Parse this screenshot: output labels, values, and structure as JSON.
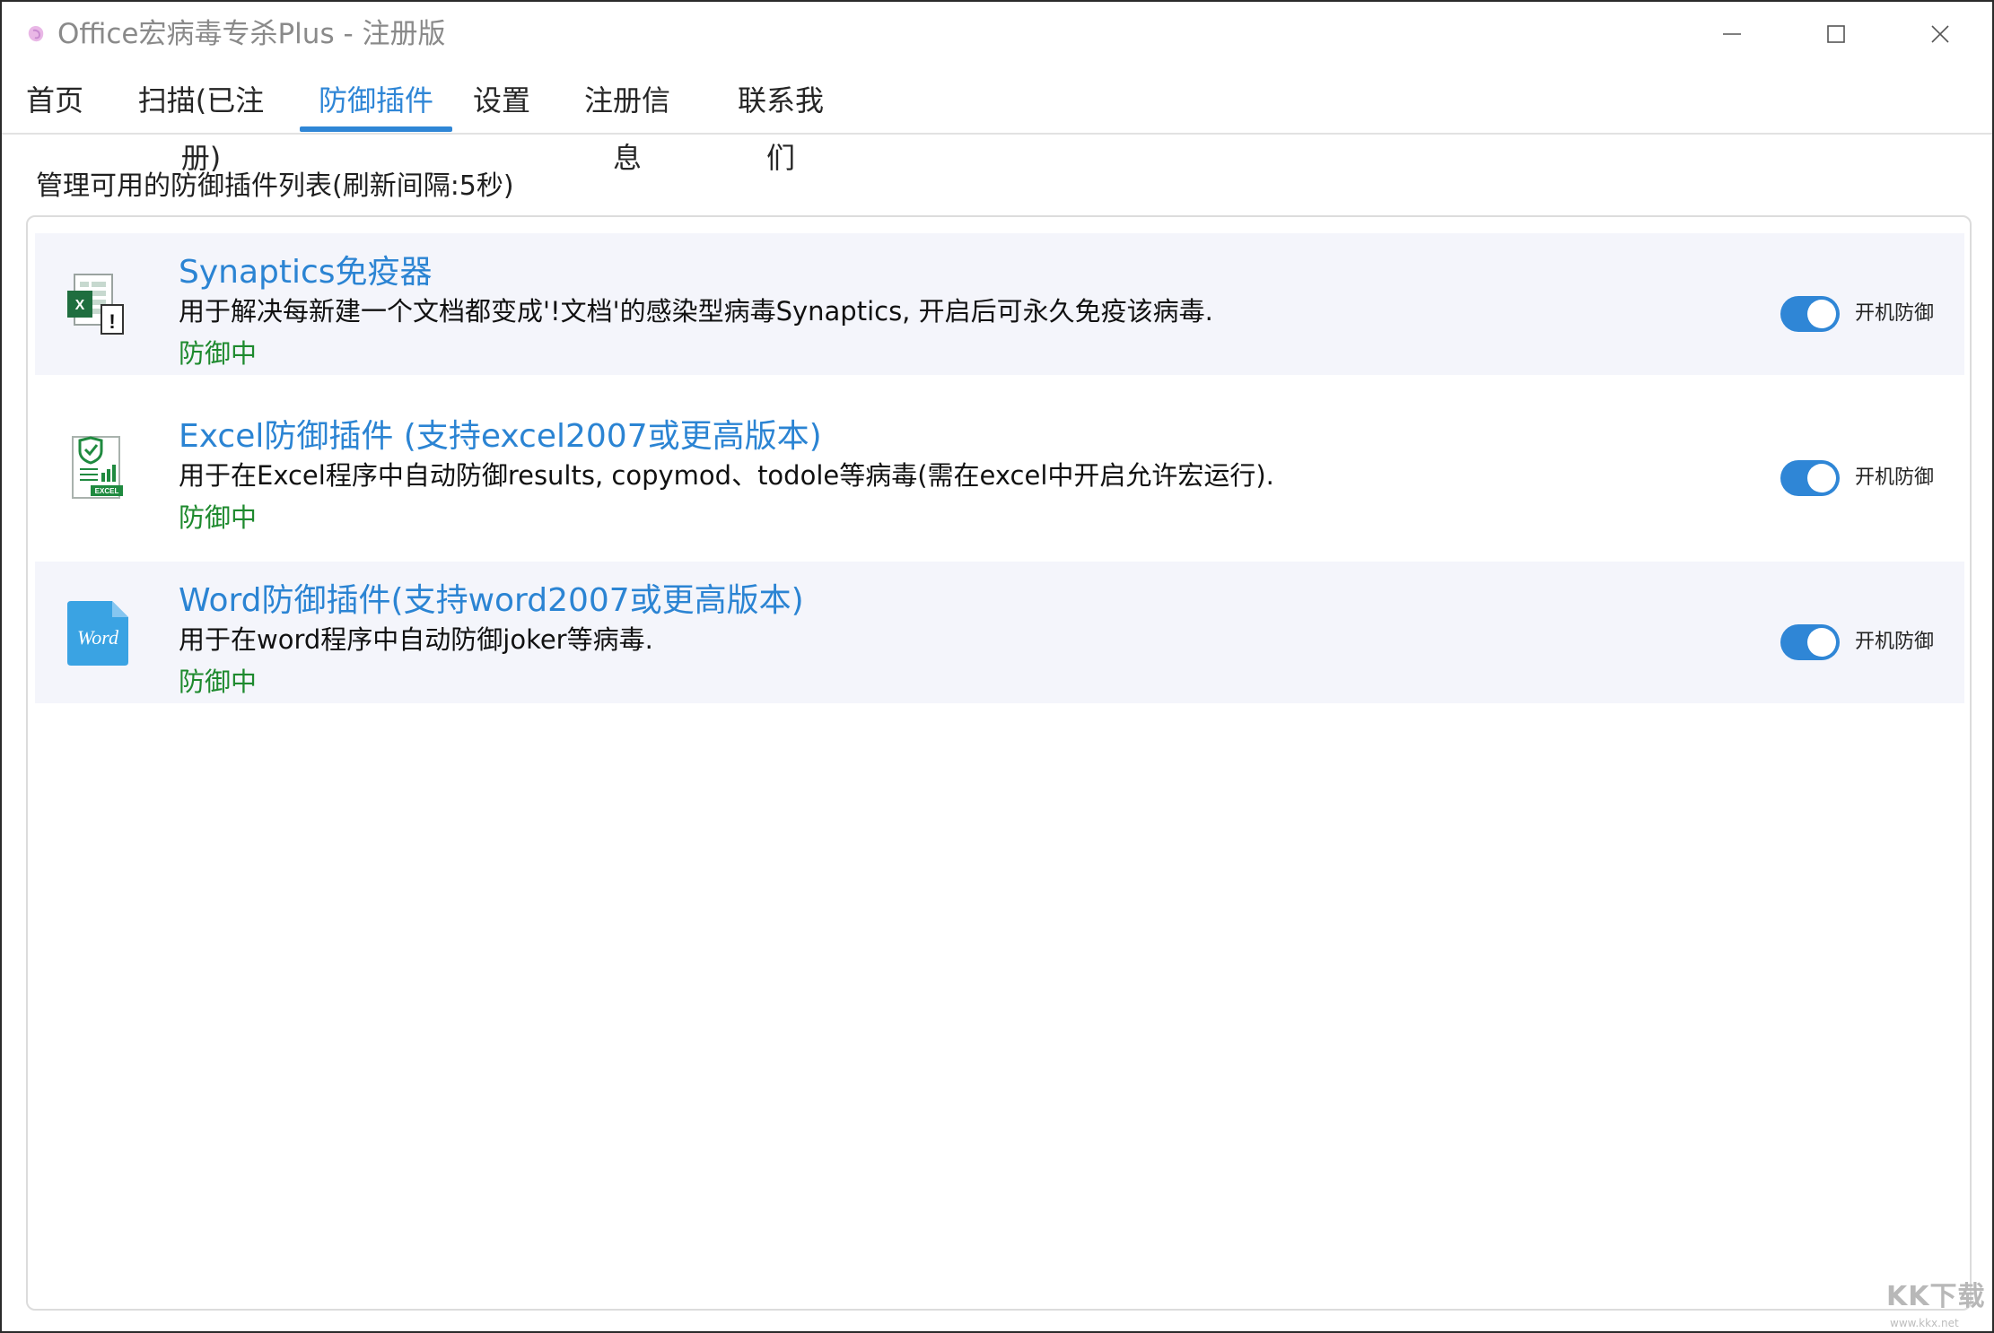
{
  "window": {
    "title": "Office宏病毒专杀Plus - 注册版",
    "controls": {
      "minimize": "—",
      "maximize": "☐",
      "close": "✕"
    }
  },
  "tabs": [
    {
      "label": "首页",
      "active": false
    },
    {
      "label": "扫描(已注册)",
      "active": false
    },
    {
      "label": "防御插件",
      "active": true
    },
    {
      "label": "设置",
      "active": false
    },
    {
      "label": "注册信息",
      "active": false
    },
    {
      "label": "联系我们",
      "active": false
    }
  ],
  "main": {
    "subtitle": "管理可用的防御插件列表(刷新间隔:5秒)",
    "plugins": [
      {
        "icon": "excel-warning-icon",
        "title": "Synaptics免疫器",
        "description": "用于解决每新建一个文档都变成'!文档'的感染型病毒Synaptics, 开启后可永久免疫该病毒.",
        "status": "防御中",
        "toggle_on": true,
        "toggle_label": "开机防御"
      },
      {
        "icon": "excel-shield-icon",
        "title": "Excel防御插件 (支持excel2007或更高版本)",
        "description": "用于在Excel程序中自动防御results, copymod、todole等病毒(需在excel中开启允许宏运行).",
        "status": "防御中",
        "toggle_on": true,
        "toggle_label": "开机防御"
      },
      {
        "icon": "word-document-icon",
        "title": "Word防御插件(支持word2007或更高版本)",
        "description": "用于在word程序中自动防御joker等病毒.",
        "status": "防御中",
        "toggle_on": true,
        "toggle_label": "开机防御"
      }
    ]
  },
  "icon_text": {
    "excel_x": "X",
    "excel_badge": "EXCEL",
    "word_text": "Word"
  },
  "watermark": {
    "text": "KK下载",
    "sub": "www.kkx.net"
  },
  "colors": {
    "accent": "#2f86d6",
    "status_green": "#1e8a2e",
    "row_shade": "#f4f5fb"
  }
}
